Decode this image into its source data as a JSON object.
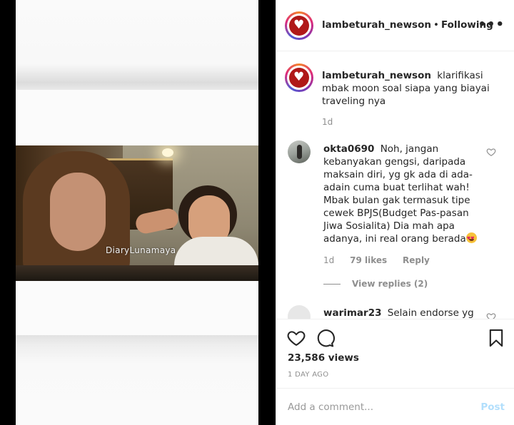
{
  "video": {
    "watermark": "DiaryLunamaya"
  },
  "header": {
    "username": "lambeturah_newson",
    "separator": "•",
    "follow_status": "Following",
    "more_label": "•••"
  },
  "caption": {
    "username": "lambeturah_newson",
    "text": "klarifikasi mbak moon soal siapa yang biayai traveling nya",
    "time": "1d"
  },
  "comments": [
    {
      "username": "okta0690",
      "text": "Noh, jangan kebanyakan gengsi, daripada maksain diri, yg gk ada di ada-adain cuma buat terlihat wah! Mbak bulan gak termasuk tipe cewek BPJS(Budget Pas-pasan Jiwa Sosialita) Dia mah apa adanya, ini real orang berada",
      "emoji_icon": "star-struck-emoji",
      "time": "1d",
      "likes": "79 likes",
      "reply_label": "Reply",
      "view_replies": "View replies (2)"
    },
    {
      "username": "warimar23",
      "text": "Selain endorse yg byk,"
    }
  ],
  "actions": {
    "like_icon": "heart-outline-icon",
    "comment_icon": "speech-bubble-icon",
    "save_icon": "bookmark-icon",
    "views": "23,586 views",
    "date": "1 DAY AGO"
  },
  "add_comment": {
    "placeholder": "Add a comment...",
    "post_label": "Post"
  },
  "colors": {
    "post_disabled": "#b2dffc",
    "muted_text": "#8e8e8e",
    "border": "#efefef"
  }
}
